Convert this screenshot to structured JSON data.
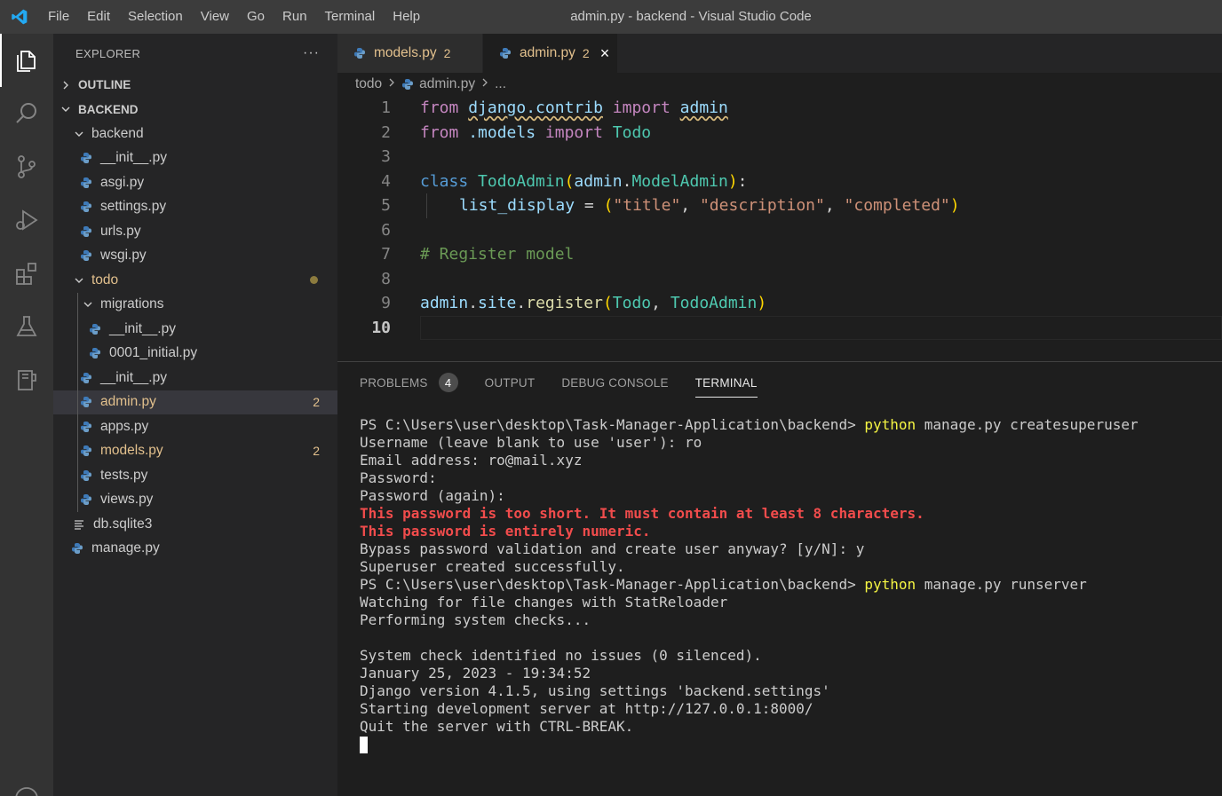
{
  "window": {
    "title": "admin.py - backend - Visual Studio Code"
  },
  "menu": [
    "File",
    "Edit",
    "Selection",
    "View",
    "Go",
    "Run",
    "Terminal",
    "Help"
  ],
  "activity_bar": [
    "explorer-icon",
    "search-icon",
    "source-control-icon",
    "run-debug-icon",
    "extensions-icon",
    "testing-icon",
    "notebook-icon",
    "account-icon"
  ],
  "sidebar": {
    "header": "EXPLORER",
    "more": "···",
    "outline": "OUTLINE",
    "workspace": "BACKEND",
    "tree": [
      {
        "label": "backend",
        "type": "folder"
      },
      {
        "label": "__init__.py",
        "type": "py"
      },
      {
        "label": "asgi.py",
        "type": "py"
      },
      {
        "label": "settings.py",
        "type": "py"
      },
      {
        "label": "urls.py",
        "type": "py"
      },
      {
        "label": "wsgi.py",
        "type": "py"
      },
      {
        "label": "todo",
        "type": "folder"
      },
      {
        "label": "migrations",
        "type": "folder"
      },
      {
        "label": "__init__.py",
        "type": "py"
      },
      {
        "label": "0001_initial.py",
        "type": "py"
      },
      {
        "label": "__init__.py",
        "type": "py"
      },
      {
        "label": "admin.py",
        "type": "py",
        "badge": "2"
      },
      {
        "label": "apps.py",
        "type": "py"
      },
      {
        "label": "models.py",
        "type": "py",
        "badge": "2"
      },
      {
        "label": "tests.py",
        "type": "py"
      },
      {
        "label": "views.py",
        "type": "py"
      },
      {
        "label": "db.sqlite3",
        "type": "file"
      },
      {
        "label": "manage.py",
        "type": "py"
      }
    ]
  },
  "tabs": [
    {
      "label": "models.py",
      "count": "2"
    },
    {
      "label": "admin.py",
      "count": "2",
      "close": "×"
    }
  ],
  "breadcrumb": {
    "folder": "todo",
    "file": "admin.py",
    "more": "..."
  },
  "code": {
    "line_numbers": [
      "1",
      "2",
      "3",
      "4",
      "5",
      "6",
      "7",
      "8",
      "9",
      "10"
    ],
    "l1": [
      "from",
      "django.contrib",
      "import",
      "admin"
    ],
    "l2": [
      "from",
      ".models",
      "import",
      "Todo"
    ],
    "l4": [
      "class",
      "TodoAdmin",
      "(",
      "admin",
      ".",
      "ModelAdmin",
      ")",
      ":"
    ],
    "l5": [
      "list_display",
      "=",
      "(",
      "\"title\"",
      ",",
      "\"description\"",
      ",",
      "\"completed\"",
      ")"
    ],
    "l7": "# Register model",
    "l9": [
      "admin",
      ".",
      "site",
      ".",
      "register",
      "(",
      "Todo",
      ",",
      "TodoAdmin",
      ")"
    ]
  },
  "panel": {
    "tabs": [
      "PROBLEMS",
      "OUTPUT",
      "DEBUG CONSOLE",
      "TERMINAL"
    ],
    "problems_count": "4",
    "terminal": {
      "prompt": "PS C:\\Users\\user\\desktop\\Task-Manager-Application\\backend>",
      "cmd_python": "python",
      "cmd1_args": "manage.py createsuperuser",
      "lines_a": [
        "Username (leave blank to use 'user'): ro",
        "Email address: ro@mail.xyz",
        "Password:",
        "Password (again):"
      ],
      "errors": [
        "This password is too short. It must contain at least 8 characters.",
        "This password is entirely numeric."
      ],
      "lines_b": [
        "Bypass password validation and create user anyway? [y/N]: y",
        "Superuser created successfully."
      ],
      "cmd2_args": "manage.py runserver",
      "lines_c": [
        "Watching for file changes with StatReloader",
        "Performing system checks...",
        "",
        "System check identified no issues (0 silenced).",
        "January 25, 2023 - 19:34:52",
        "Django version 4.1.5, using settings 'backend.settings'",
        "Starting development server at http://127.0.0.1:8000/",
        "Quit the server with CTRL-BREAK."
      ]
    }
  }
}
